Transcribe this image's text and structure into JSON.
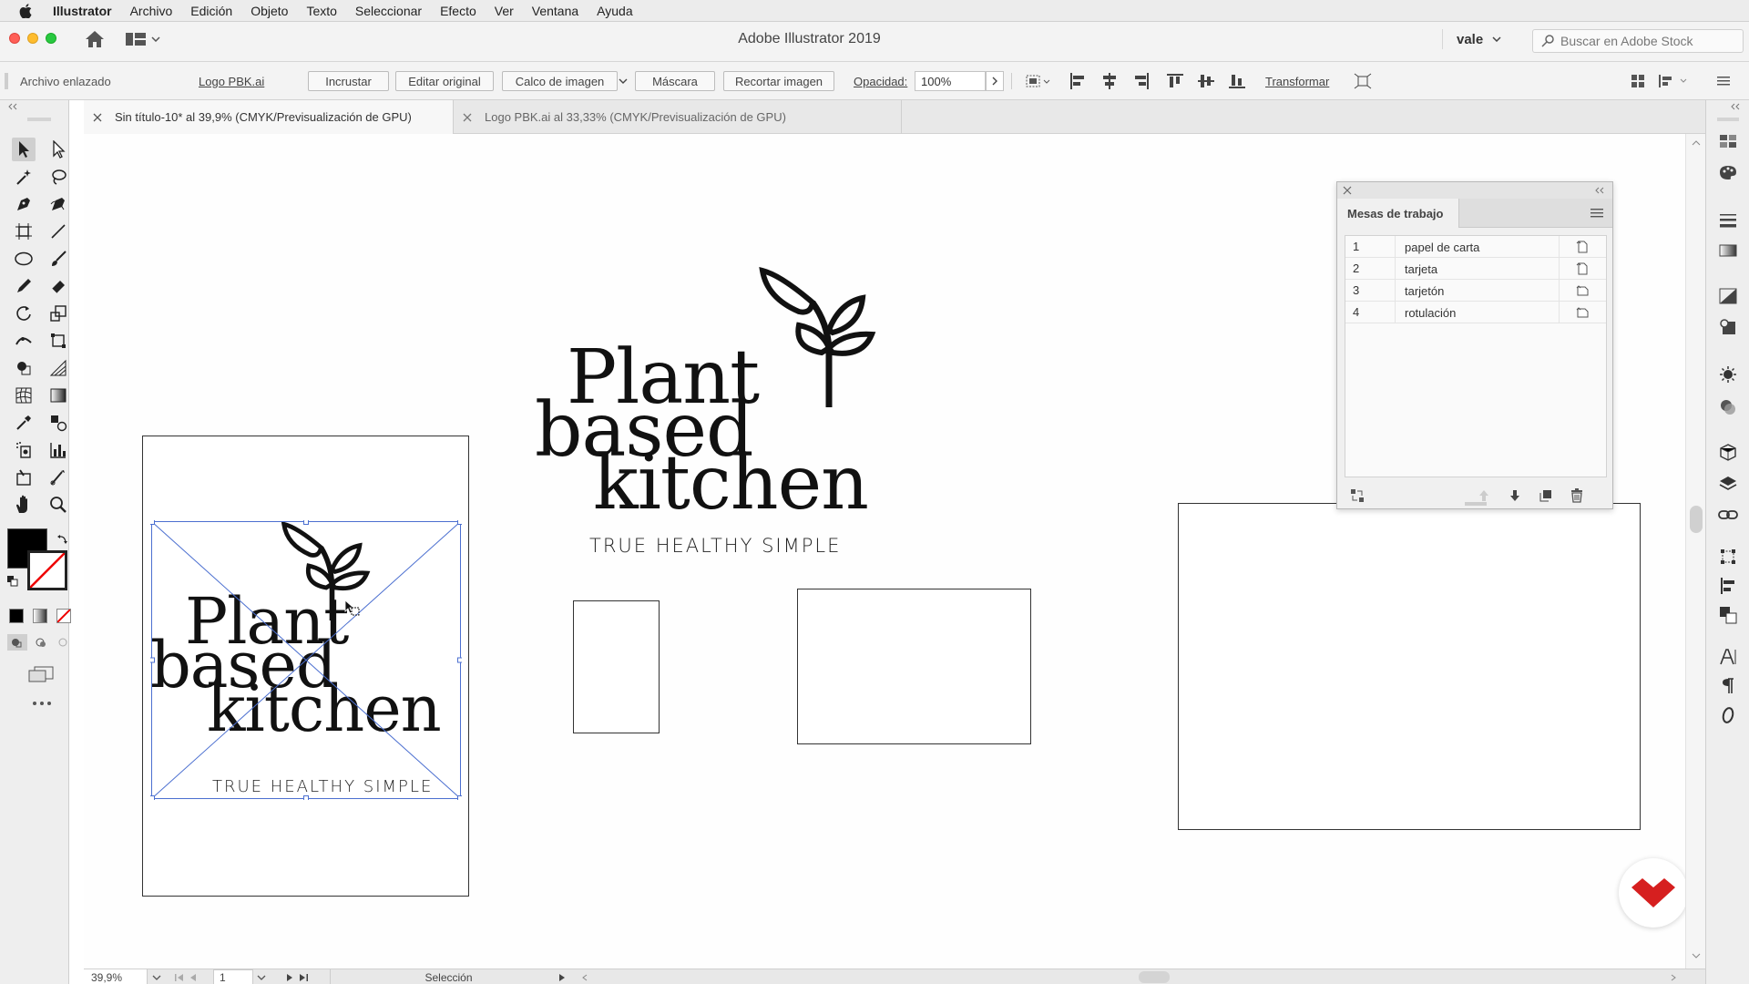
{
  "menubar": {
    "app": "Illustrator",
    "items": [
      "Archivo",
      "Edición",
      "Objeto",
      "Texto",
      "Seleccionar",
      "Efecto",
      "Ver",
      "Ventana",
      "Ayuda"
    ]
  },
  "titlebar": {
    "title": "Adobe Illustrator 2019",
    "user": "vale",
    "stock_search_placeholder": "Buscar en Adobe Stock"
  },
  "controlbar": {
    "linked_file": "Archivo enlazado",
    "file_name": "Logo PBK.ai",
    "embed": "Incrustar",
    "edit_original": "Editar original",
    "image_trace": "Calco de imagen",
    "mask": "Máscara",
    "crop_image": "Recortar imagen",
    "opacity_label": "Opacidad:",
    "opacity_value": "100%",
    "transform": "Transformar"
  },
  "tabs": [
    {
      "label": "Sin título-10* al 39,9% (CMYK/Previsualización de GPU)",
      "active": true
    },
    {
      "label": "Logo PBK.ai al 33,33% (CMYK/Previsualización de GPU)",
      "active": false
    }
  ],
  "artboards_panel": {
    "title": "Mesas de trabajo",
    "rows": [
      {
        "num": "1",
        "name": "papel de carta"
      },
      {
        "num": "2",
        "name": "tarjeta"
      },
      {
        "num": "3",
        "name": "tarjetón"
      },
      {
        "num": "4",
        "name": "rotulación"
      }
    ]
  },
  "logo": {
    "line1": "Plant",
    "line2": "based",
    "line3": "kitchen",
    "tagline": "TRUE HEALTHY SIMPLE"
  },
  "statusbar": {
    "zoom": "39,9%",
    "artboard_num": "1",
    "tool": "Selección"
  },
  "colors": {
    "fill": "#000000",
    "accent_badge": "#d61f1f"
  }
}
